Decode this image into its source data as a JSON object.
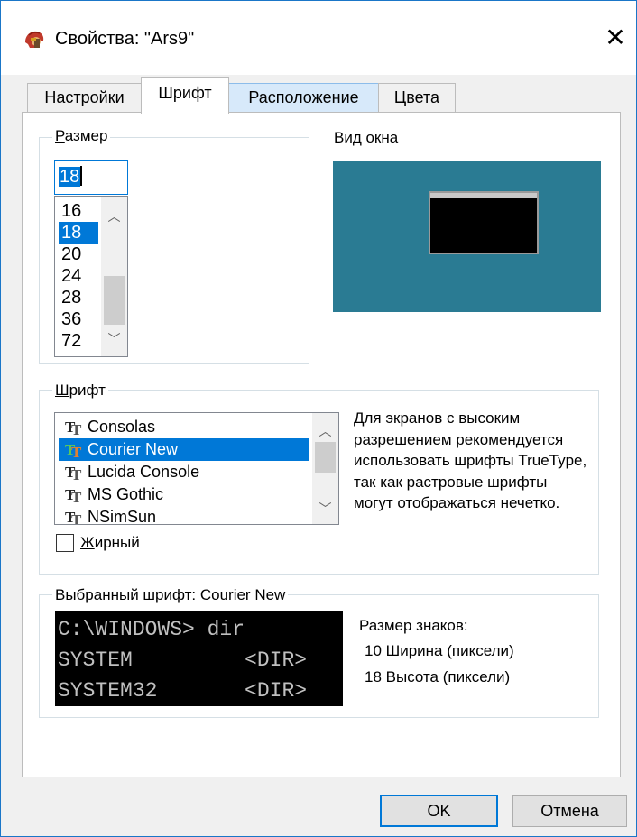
{
  "window": {
    "title": "Свойства: \"Ars9\"",
    "close_glyph": "✕"
  },
  "tabs": [
    {
      "label": "Настройки"
    },
    {
      "label": "Шрифт"
    },
    {
      "label": "Расположение"
    },
    {
      "label": "Цвета"
    }
  ],
  "size_group": {
    "label_ul": "Р",
    "label_rest": "азмер",
    "input_value": "18",
    "options": [
      "16",
      "18",
      "20",
      "24",
      "28",
      "36",
      "72"
    ],
    "selected": "18"
  },
  "preview": {
    "label": "Вид окна",
    "background_color": "#2a7b93"
  },
  "font_group": {
    "label_ul": "Ш",
    "label_rest": "рифт",
    "fonts": [
      "Consolas",
      "Courier New",
      "Lucida Console",
      "MS Gothic",
      "NSimSun"
    ],
    "selected": "Courier New",
    "bold_ul": "Ж",
    "bold_rest": "ирный",
    "bold_checked": false,
    "info_text": "Для экранов с высоким разрешением рекомендуется использовать шрифты TrueType, так как растровые шрифты могут отображаться нечетко."
  },
  "selected_font_group": {
    "label": "Выбранный шрифт: Courier New",
    "console_lines": [
      "C:\\WINDOWS> dir",
      "SYSTEM         <DIR>",
      "SYSTEM32       <DIR>"
    ],
    "metrics_title": "Размер знаков:",
    "width_line": "10 Ширина (пиксели)",
    "height_line": "18 Высота (пиксели)"
  },
  "buttons": {
    "ok": "OK",
    "cancel": "Отмена"
  },
  "colors": {
    "accent": "#0078d7",
    "border": "#1a76c8"
  }
}
